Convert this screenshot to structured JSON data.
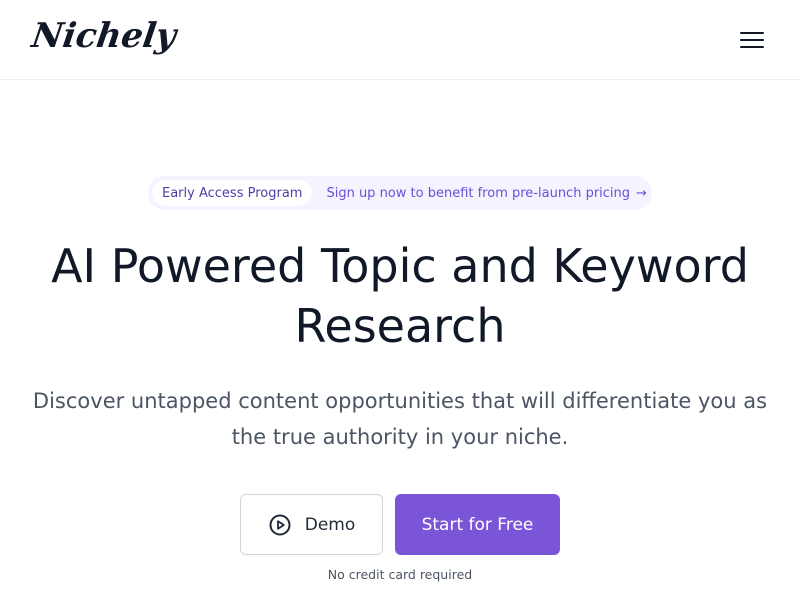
{
  "header": {
    "logo_text": "Nichely",
    "menu_icon": "hamburger-menu-icon"
  },
  "announcement": {
    "badge": "Early Access Program",
    "link_text": "Sign up now to benefit from pre-launch pricing",
    "arrow_icon": "arrow-right-icon",
    "arrow": "→"
  },
  "hero": {
    "title": "AI Powered Topic and Keyword Research",
    "subtitle": "Discover untapped content opportunities that will differentiate you as the true authority in your niche."
  },
  "actions": {
    "demo_label": "Demo",
    "demo_icon": "play-circle-icon",
    "start_label": "Start for Free",
    "note": "No credit card required"
  },
  "colors": {
    "accent": "#7b55d8",
    "accent_text": "#6d4fd6",
    "pill_bg": "#f5f3ff",
    "heading": "#111827",
    "body_text": "#4b5563"
  }
}
